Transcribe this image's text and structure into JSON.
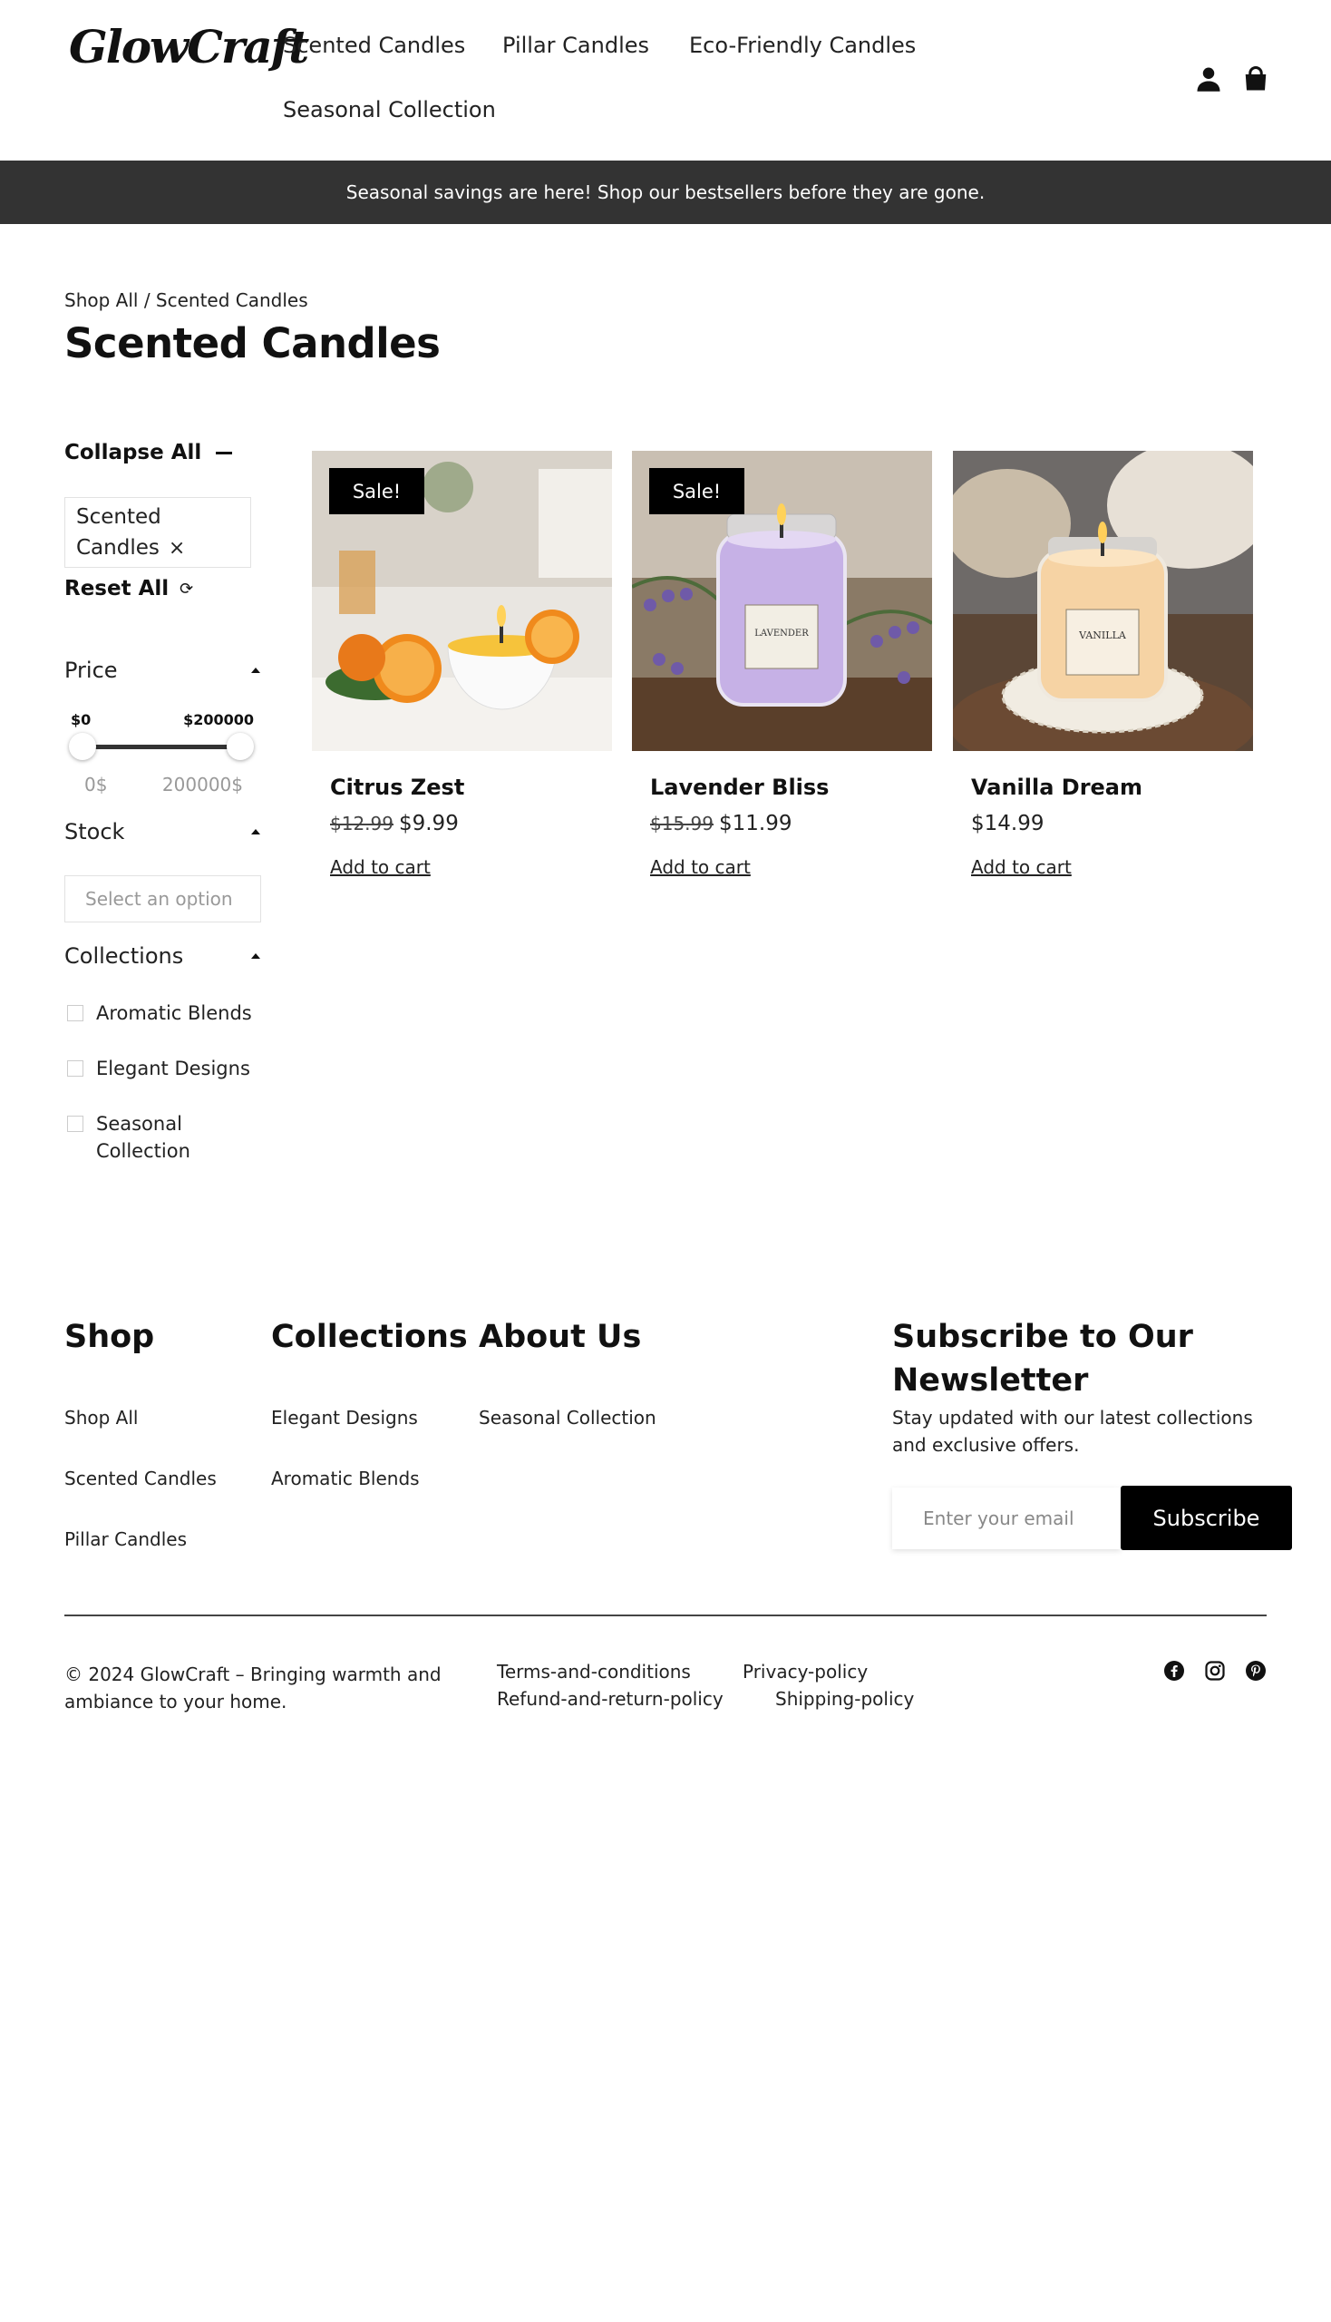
{
  "header": {
    "logo": "GlowCraft",
    "nav": [
      "Scented Candles",
      "Pillar Candles",
      "Eco-Friendly Candles",
      "Seasonal Collection"
    ],
    "icons": [
      "account-icon",
      "shopping-bag-icon"
    ]
  },
  "announcement": "Seasonal savings are here! Shop our bestsellers before they are gone.",
  "breadcrumb": "Shop All / Scented Candles",
  "page_title": "Scented Candles",
  "filters": {
    "collapse_all": "Collapse All",
    "active_chip": "Scented Candles",
    "chip_remove": "×",
    "reset_all": "Reset All",
    "price": {
      "label": "Price",
      "min_label": "$0",
      "max_label": "$200000",
      "min_value": "0$",
      "max_value": "200000$"
    },
    "stock": {
      "label": "Stock",
      "placeholder": "Select an option"
    },
    "collections": {
      "label": "Collections",
      "options": [
        "Aromatic Blends",
        "Elegant Designs",
        "Seasonal Collection"
      ]
    }
  },
  "products": [
    {
      "name": "Citrus Zest",
      "badge": "Sale!",
      "old_price": "$12.99",
      "price": "$9.99",
      "cta": "Add to cart"
    },
    {
      "name": "Lavender Bliss",
      "badge": "Sale!",
      "old_price": "$15.99",
      "price": "$11.99",
      "cta": "Add to cart"
    },
    {
      "name": "Vanilla Dream",
      "badge": "",
      "old_price": "",
      "price": "$14.99",
      "cta": "Add to cart"
    }
  ],
  "product_images": {
    "jar_label_lavender": "LAVENDER",
    "jar_label_vanilla": "VANILLA"
  },
  "footer": {
    "shop": {
      "title": "Shop",
      "links": [
        "Shop All",
        "Scented Candles",
        "Pillar Candles"
      ]
    },
    "collections": {
      "title": "Collections",
      "links": [
        "Elegant Designs",
        "Aromatic Blends"
      ]
    },
    "about": {
      "title": "About Us",
      "links": [
        "Seasonal Collection"
      ]
    },
    "newsletter": {
      "title": "Subscribe to Our Newsletter",
      "description": "Stay updated with our latest collections and exclusive offers.",
      "placeholder": "Enter your email",
      "button": "Subscribe"
    },
    "copyright": "© 2024 GlowCraft – Bringing warmth and ambiance to your home.",
    "policies": [
      "Terms-and-conditions",
      "Privacy-policy",
      "Refund-and-return-policy",
      "Shipping-policy"
    ],
    "social": [
      "facebook-icon",
      "instagram-icon",
      "pinterest-icon"
    ]
  },
  "colors": {
    "announcement_bg": "#333333",
    "button_bg": "#000000",
    "text": "#111111"
  }
}
